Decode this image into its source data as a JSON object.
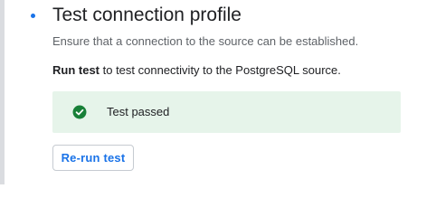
{
  "step": {
    "title": "Test connection profile",
    "description": "Ensure that a connection to the source can be established.",
    "instruction_bold": "Run test",
    "instruction_rest": " to test connectivity to the PostgreSQL source."
  },
  "status": {
    "text": "Test passed",
    "icon": "check-circle-icon",
    "color": "#188038",
    "background": "#e6f4ea"
  },
  "actions": {
    "rerun_label": "Re-run test"
  },
  "colors": {
    "accent": "#1a73e8"
  }
}
